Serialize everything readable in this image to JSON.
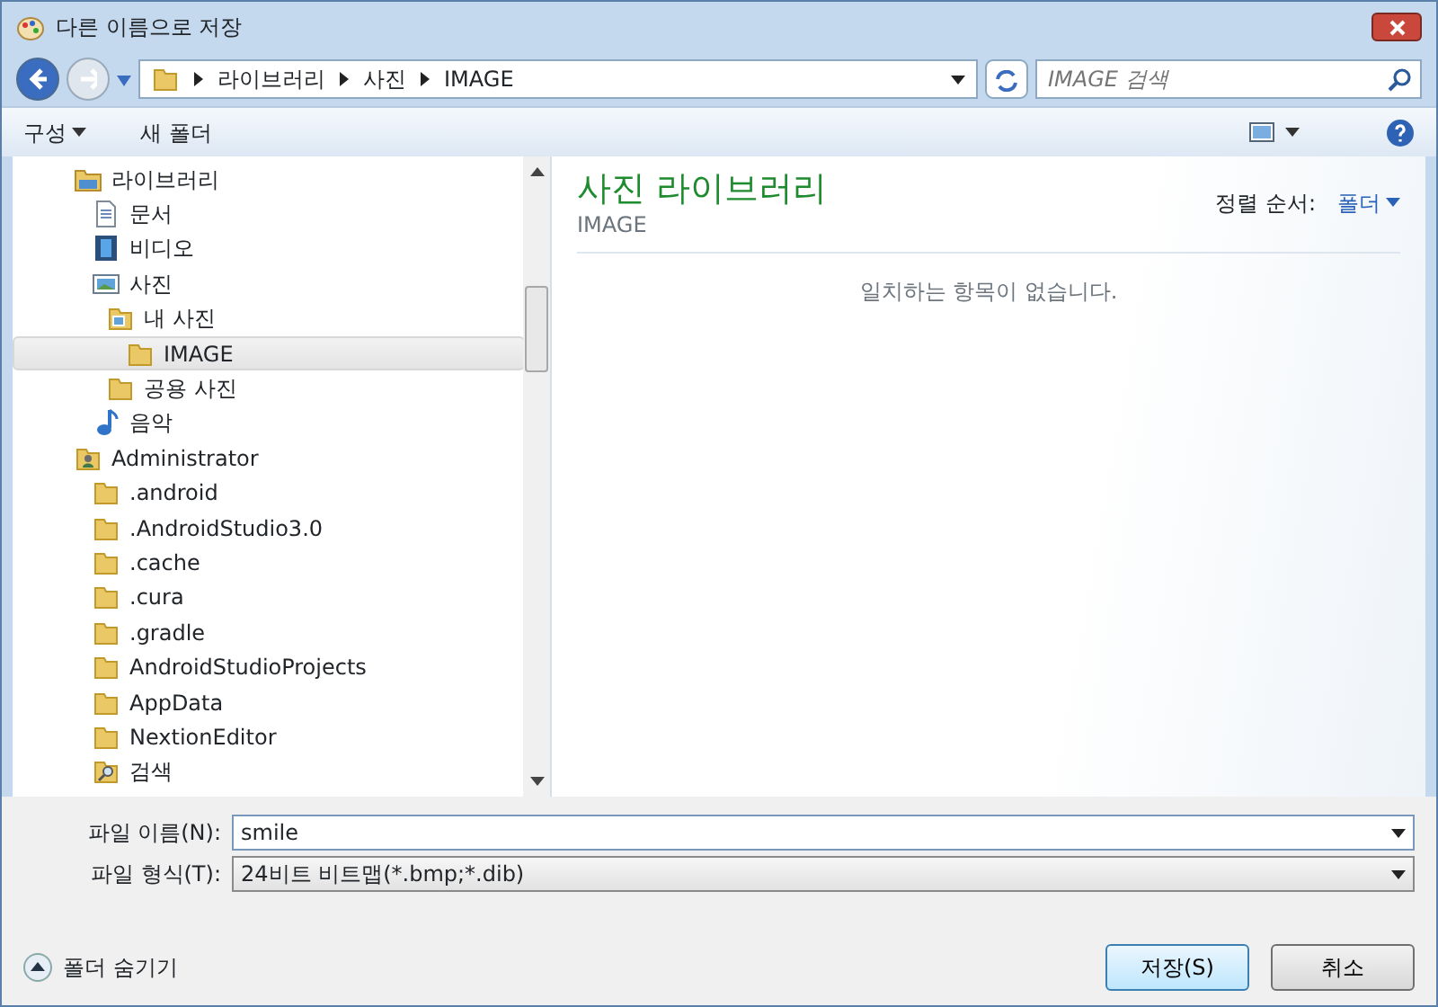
{
  "window": {
    "title": "다른 이름으로 저장"
  },
  "address": {
    "crumbs": [
      "라이브러리",
      "사진",
      "IMAGE"
    ]
  },
  "search": {
    "placeholder": "IMAGE 검색"
  },
  "toolbar": {
    "organize": "구성",
    "new_folder": "새 폴더"
  },
  "tree": [
    {
      "label": "라이브러리",
      "kind": "library",
      "selected": false,
      "children": [
        {
          "label": "문서",
          "kind": "document",
          "selected": false
        },
        {
          "label": "비디오",
          "kind": "video",
          "selected": false
        },
        {
          "label": "사진",
          "kind": "picture",
          "selected": false,
          "children": [
            {
              "label": "내 사진",
              "kind": "picfolder",
              "selected": false,
              "children": [
                {
                  "label": "IMAGE",
                  "kind": "folder",
                  "selected": true
                }
              ]
            },
            {
              "label": "공용 사진",
              "kind": "folder",
              "selected": false
            }
          ]
        },
        {
          "label": "음악",
          "kind": "music",
          "selected": false
        }
      ]
    },
    {
      "label": "Administrator",
      "kind": "user",
      "selected": false,
      "children": [
        {
          "label": ".android",
          "kind": "folder",
          "selected": false
        },
        {
          "label": ".AndroidStudio3.0",
          "kind": "folder",
          "selected": false
        },
        {
          "label": ".cache",
          "kind": "folder",
          "selected": false
        },
        {
          "label": ".cura",
          "kind": "folder",
          "selected": false
        },
        {
          "label": ".gradle",
          "kind": "folder",
          "selected": false
        },
        {
          "label": "AndroidStudioProjects",
          "kind": "folder",
          "selected": false
        },
        {
          "label": "AppData",
          "kind": "folder",
          "selected": false
        },
        {
          "label": "NextionEditor",
          "kind": "folder",
          "selected": false
        },
        {
          "label": "검색",
          "kind": "search",
          "selected": false
        }
      ]
    }
  ],
  "content": {
    "title": "사진 라이브러리",
    "subtitle": "IMAGE",
    "sort_label": "정렬 순서:",
    "sort_value": "폴더",
    "empty": "일치하는 항목이 없습니다."
  },
  "form": {
    "filename_label": "파일 이름(N):",
    "filename": "smile",
    "filetype_label": "파일 형식(T):",
    "filetype": "24비트 비트맵(*.bmp;*.dib)"
  },
  "hide_folders": "폴더 숨기기",
  "buttons": [
    "저장(S)",
    "취소"
  ]
}
